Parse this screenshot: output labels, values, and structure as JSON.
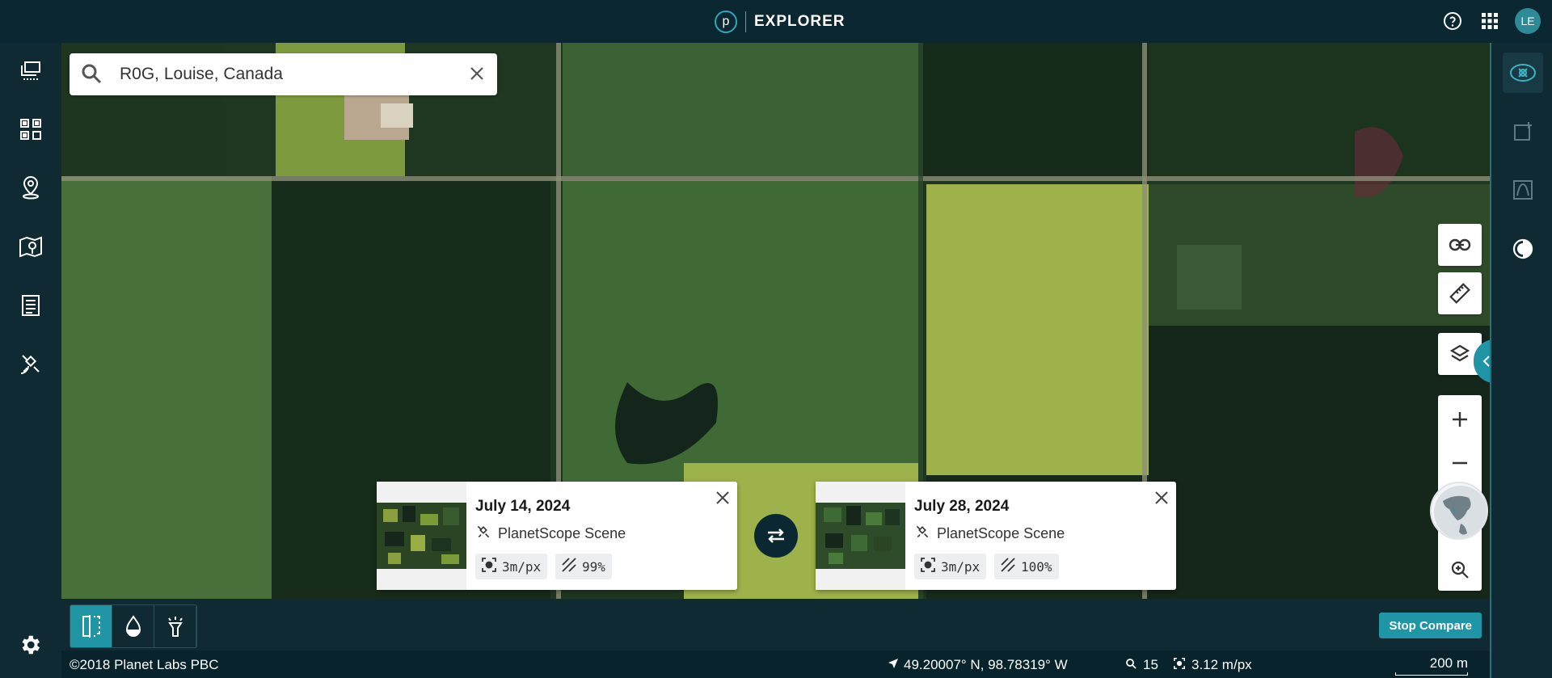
{
  "app": {
    "logo_letter": "p",
    "title": "EXPLORER"
  },
  "header": {
    "help_icon": "help-circle-icon",
    "apps_icon": "apps-grid-icon",
    "avatar_initials": "LE"
  },
  "left_sidebar": {
    "items": [
      {
        "name": "stacks-icon"
      },
      {
        "name": "qr-grid-icon"
      },
      {
        "name": "location-pin-icon"
      },
      {
        "name": "map-pin-icon"
      },
      {
        "name": "notes-icon"
      },
      {
        "name": "satellite-icon"
      }
    ],
    "settings_icon": "gear-icon"
  },
  "right_sidebar": {
    "items": [
      {
        "name": "compare-scenes-icon",
        "active": true
      },
      {
        "name": "add-image-icon",
        "active": false
      },
      {
        "name": "chart-icon",
        "active": false
      },
      {
        "name": "contrast-icon",
        "active": false
      }
    ]
  },
  "search": {
    "value": "R0G, Louise, Canada"
  },
  "map_controls": [
    "link-icon",
    "ruler-icon",
    "layers-icon",
    "zoom-in-icon",
    "zoom-out-icon",
    "globe-icon",
    "zoom-search-icon"
  ],
  "compare": {
    "left_card": {
      "date": "July 14, 2024",
      "type": "PlanetScope Scene",
      "resolution": "3m/px",
      "coverage": "99%"
    },
    "right_card": {
      "date": "July 28, 2024",
      "type": "PlanetScope Scene",
      "resolution": "3m/px",
      "coverage": "100%"
    },
    "swap_icon": "swap-arrows-icon"
  },
  "tools": [
    {
      "name": "split-view-icon",
      "active": true
    },
    {
      "name": "drop-icon",
      "active": false
    },
    {
      "name": "flashlight-icon",
      "active": false
    }
  ],
  "stop_compare_label": "Stop Compare",
  "status": {
    "copyright": "©2018 Planet Labs PBC",
    "coordinates": "49.20007° N, 98.78319° W",
    "zoom": "15",
    "resolution": "3.12 m/px",
    "scale": "200 m"
  },
  "colors": {
    "accent": "#1f95a6",
    "dark": "#0f2a33"
  }
}
